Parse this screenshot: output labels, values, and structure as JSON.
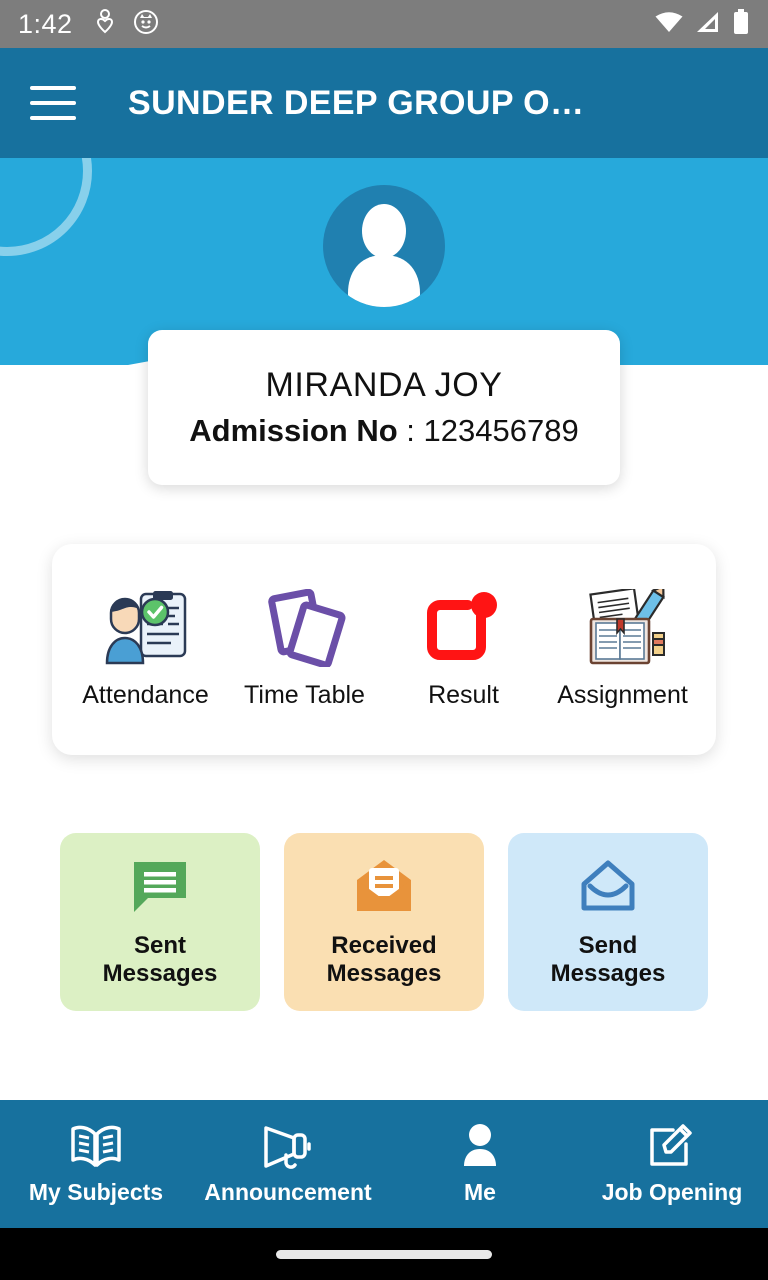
{
  "status_bar": {
    "time": "1:42",
    "left_icons": [
      "heart-person-notification-icon",
      "cat-face-notification-icon"
    ],
    "right_icons": [
      "wifi-icon",
      "cellular-signal-icon",
      "battery-icon"
    ]
  },
  "app_bar": {
    "menu_icon": "hamburger-menu-icon",
    "title": "SUNDER DEEP GROUP O…"
  },
  "colors": {
    "header_blue": "#17719e",
    "hero_blue": "#27a9db",
    "avatar_blue": "#2080b0",
    "sent_tile": "#dcf0c4",
    "received_tile": "#fadfb2",
    "send_tile": "#cfe8f9",
    "result_red": "#ff1414",
    "timetable_purple": "#6b4fa8",
    "status_bar_gray": "#7d7d7d"
  },
  "profile": {
    "avatar_icon": "user-avatar-icon",
    "name": "MIRANDA JOY",
    "admission_label": "Admission No",
    "admission_separator": " : ",
    "admission_number": "123456789"
  },
  "quick_actions": [
    {
      "label": "Attendance",
      "icon": "attendance-clipboard-icon"
    },
    {
      "label": "Time  Table",
      "icon": "timetable-cards-icon"
    },
    {
      "label": "Result",
      "icon": "result-notification-square-icon"
    },
    {
      "label": "Assignment",
      "icon": "assignment-book-pencil-icon"
    }
  ],
  "message_tiles": [
    {
      "label_line1": "Sent",
      "label_line2": "Messages",
      "icon": "chat-bubble-icon",
      "bg": "#dcf0c4"
    },
    {
      "label_line1": "Received",
      "label_line2": "Messages",
      "icon": "open-envelope-filled-icon",
      "bg": "#fadfb2"
    },
    {
      "label_line1": "Send",
      "label_line2": "Messages",
      "icon": "open-envelope-outline-icon",
      "bg": "#cfe8f9"
    }
  ],
  "bottom_nav": [
    {
      "label": "My Subjects",
      "icon": "open-book-icon"
    },
    {
      "label": "Announcement",
      "icon": "megaphone-icon"
    },
    {
      "label": "Me",
      "icon": "person-icon"
    },
    {
      "label": "Job Opening",
      "icon": "edit-square-pencil-icon"
    }
  ],
  "gesture_bar": {
    "handle": "home-gesture-pill"
  }
}
